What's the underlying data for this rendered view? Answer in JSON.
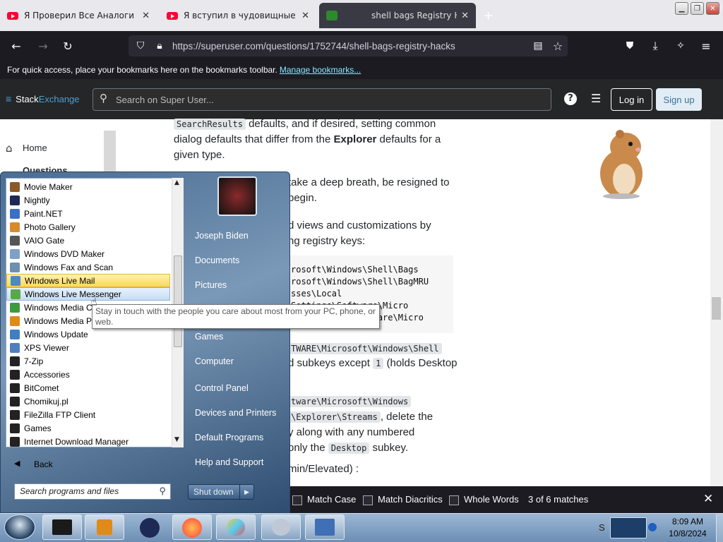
{
  "tabs": [
    {
      "title": "Я Проверил Все Аналоги Ютуб",
      "close": "✕"
    },
    {
      "title": "Я вступил в чудовищные груп",
      "close": "✕"
    },
    {
      "title": "shell bags Registry H",
      "close": "✕"
    }
  ],
  "new_tab": "+",
  "url": "https://superuser.com/questions/1752744/shell-bags-registry-hacks",
  "bookmarks_bar": {
    "text": "For quick access, place your bookmarks here on the bookmarks toolbar.",
    "link": "Manage bookmarks..."
  },
  "se_header": {
    "logo_a": "Stack",
    "logo_b": "Exchange",
    "search_placeholder": "Search on Super User...",
    "login": "Log in",
    "signup": "Sign up"
  },
  "left_nav": {
    "home": "Home",
    "questions": "Questions"
  },
  "article": {
    "l1_code": "SearchResults",
    "l1_text": "defaults, and if desired, setting common",
    "l2a": "dialog defaults that differ from the ",
    "l2b": "Explorer",
    "l2c": " defaults for a",
    "l3": "given type.",
    "l4": "take a deep breath, be resigned to",
    "l5": "begin.",
    "l6": "d views and customizations by",
    "l7": "ng registry keys:",
    "code_lines": [
      "rosoft\\Windows\\Shell\\Bags",
      "rosoft\\Windows\\Shell\\BagMRU",
      "sses\\Local Settings\\Software\\Micro",
      "al Settings\\Software\\Micro"
    ],
    "l8_code": "TWARE\\Microsoft\\Windows\\Shell",
    "l9a": "d subkeys except ",
    "l9_code": "1",
    "l9b": " (holds Desktop",
    "l10_code": "tware\\Microsoft\\Windows",
    "l11_code": "\\Explorer\\Streams",
    "l11b": ", delete the",
    "l12": "y along with any numbered",
    "l13a": "only the ",
    "l13_code": "Desktop",
    "l13b": " subkey.",
    "l14": "min/Elevated) :"
  },
  "findbar": {
    "match_case": "Match Case",
    "match_diacritics": "Match Diacritics",
    "whole_words": "Whole Words",
    "count": "3 of 6 matches"
  },
  "start_menu": {
    "programs": [
      {
        "label": "Movie Maker",
        "color": "#8a5a2b"
      },
      {
        "label": "Nightly",
        "color": "#1d2a55"
      },
      {
        "label": "Paint.NET",
        "color": "#3a6fc4"
      },
      {
        "label": "Photo Gallery",
        "color": "#d98b2b"
      },
      {
        "label": "VAIO Gate",
        "color": "#555555"
      },
      {
        "label": "Windows DVD Maker",
        "color": "#7fa0c9"
      },
      {
        "label": "Windows Fax and Scan",
        "color": "#6f8fb0"
      },
      {
        "label": "Windows Live Mail",
        "color": "#4f88c9"
      },
      {
        "label": "Windows Live Messenger",
        "color": "#5aa84a"
      },
      {
        "label": "Windows Media Ce",
        "color": "#3d9a3d"
      },
      {
        "label": "Windows Media P",
        "color": "#e08a1a"
      },
      {
        "label": "Windows Update",
        "color": "#3f7fc0"
      },
      {
        "label": "XPS Viewer",
        "color": "#4f7fbf"
      },
      {
        "label": "7-Zip",
        "color": "#222222"
      },
      {
        "label": "Accessories",
        "color": "#222222"
      },
      {
        "label": "BitComet",
        "color": "#222222"
      },
      {
        "label": "Chomikuj.pl",
        "color": "#222222"
      },
      {
        "label": "FileZilla FTP Client",
        "color": "#222222"
      },
      {
        "label": "Games",
        "color": "#222222"
      },
      {
        "label": "Internet Download Manager",
        "color": "#222222"
      }
    ],
    "back": "Back",
    "search_placeholder": "Search programs and files",
    "right": [
      "Joseph Biden",
      "Documents",
      "Pictures",
      "Games",
      "Computer",
      "Control Panel",
      "Devices and Printers",
      "Default Programs",
      "Help and Support"
    ],
    "shutdown": "Shut down",
    "tooltip": "Stay in touch with the people you care about most from your PC, phone, or web."
  },
  "taskbar": {
    "time": "8:09 AM",
    "date": "10/8/2024",
    "tray_letter": "S"
  }
}
